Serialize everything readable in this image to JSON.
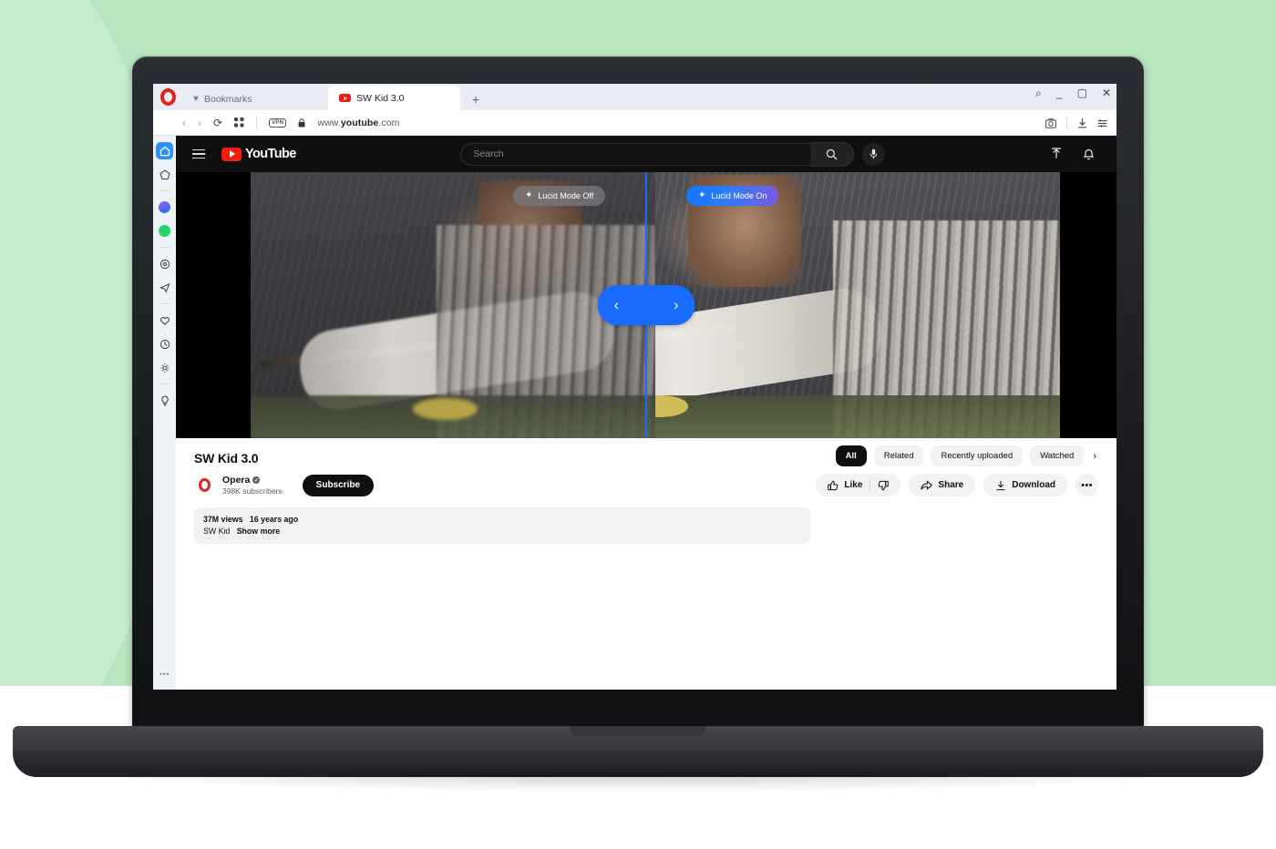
{
  "browser": {
    "name": "Opera",
    "tabs": [
      {
        "label": "Bookmarks",
        "icon": "heart-icon",
        "active": false
      },
      {
        "label": "SW Kid 3.0",
        "icon": "youtube-favicon",
        "active": true
      }
    ],
    "new_tab_label": "+",
    "window_controls": {
      "search": "⌕",
      "minimize": "_",
      "maximize": "▢",
      "close": "✕"
    },
    "address_bar": {
      "back": "‹",
      "forward": "›",
      "reload": "⟳",
      "extensions": "grid-icon",
      "vpn_badge": "VPN",
      "lock": "lock-icon",
      "url_prefix": "www.",
      "url_domain": "youtube",
      "url_suffix": ".com",
      "right_icons": [
        "snapshot-icon",
        "downloads-icon",
        "easy-setup-icon"
      ]
    },
    "sidebar": {
      "items": [
        {
          "name": "home",
          "icon": "home-icon",
          "active": true
        },
        {
          "name": "aria-ai",
          "icon": "pentagon-icon",
          "active": false
        },
        {
          "name": "divider-1",
          "icon": "divider",
          "active": false
        },
        {
          "name": "messenger",
          "icon": "messenger-icon",
          "active": false
        },
        {
          "name": "whatsapp",
          "icon": "whatsapp-icon",
          "active": false
        },
        {
          "name": "divider-2",
          "icon": "divider",
          "active": false
        },
        {
          "name": "player",
          "icon": "target-icon",
          "active": false
        },
        {
          "name": "telegram",
          "icon": "send-icon",
          "active": false
        },
        {
          "name": "divider-3",
          "icon": "divider",
          "active": false
        },
        {
          "name": "favorites",
          "icon": "heart-icon",
          "active": false
        },
        {
          "name": "history",
          "icon": "clock-icon",
          "active": false
        },
        {
          "name": "settings",
          "icon": "gear-icon",
          "active": false
        },
        {
          "name": "divider-4",
          "icon": "divider",
          "active": false
        },
        {
          "name": "tips",
          "icon": "lightbulb-icon",
          "active": false
        }
      ],
      "overflow_label": "•••"
    }
  },
  "youtube": {
    "header": {
      "menu": "hamburger-icon",
      "logo_text": "YouTube",
      "search_placeholder": "Search",
      "search_value": "",
      "search_button": "search-icon",
      "mic": "microphone-icon",
      "upload": "upload-icon",
      "notifications": "bell-icon"
    },
    "video": {
      "lucid_off_label": "Lucid Mode Off",
      "lucid_on_label": "Lucid Mode On",
      "sparkle_icon": "✦",
      "slider_left": "‹",
      "slider_right": "›",
      "divider_color": "#1a6bff",
      "badge_on_gradient_start": "#1477ff",
      "badge_on_gradient_end": "#7b5ae0"
    },
    "title": "SW Kid 3.0",
    "channel": {
      "name": "Opera",
      "verified": true,
      "subscribers": "398K subscribers",
      "subscribe_label": "Subscribe"
    },
    "actions": {
      "like_label": "Like",
      "like_icon": "thumb-up-icon",
      "dislike_icon": "thumb-down-icon",
      "share_label": "Share",
      "share_icon": "share-icon",
      "download_label": "Download",
      "download_icon": "download-icon",
      "more_label": "•••"
    },
    "description": {
      "views": "37M views",
      "published": "16 years ago",
      "tag": "SW Kid",
      "show_more": "Show more"
    },
    "chips": [
      {
        "label": "All",
        "active": true
      },
      {
        "label": "Related",
        "active": false
      },
      {
        "label": "Recently uploaded",
        "active": false
      },
      {
        "label": "Watched",
        "active": false
      }
    ],
    "chips_next": "›"
  },
  "scene": {
    "bg_color": "#b9e6bf",
    "bg_accent_color": "#c5ebca",
    "device": "laptop"
  }
}
